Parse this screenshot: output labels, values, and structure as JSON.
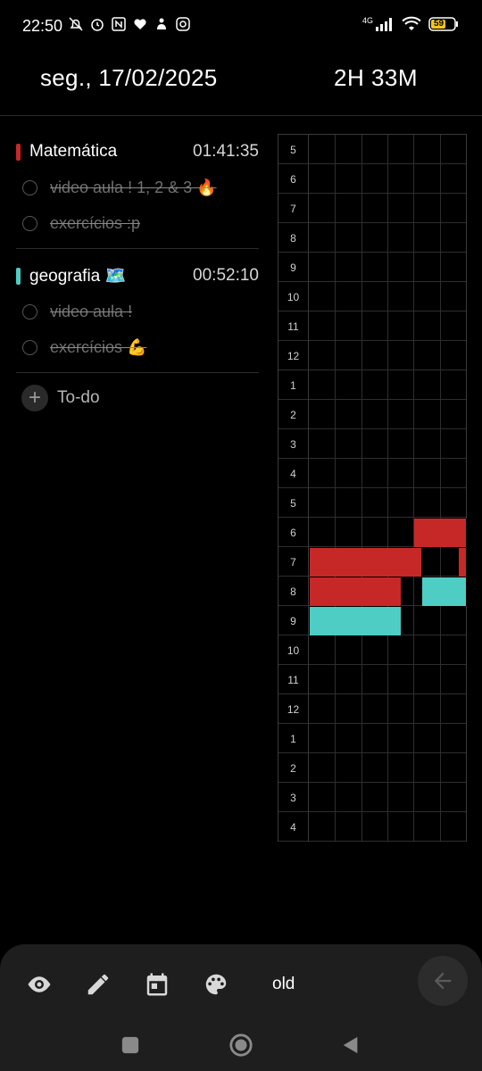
{
  "status_bar": {
    "time": "22:50",
    "battery": "59",
    "network": "4G"
  },
  "header": {
    "date": "seg., 17/02/2025",
    "total_time": "2H 33M"
  },
  "subjects": [
    {
      "name": "Matemática",
      "time": "01:41:35",
      "color": "#c62828",
      "tasks": [
        {
          "label": "video aula ! 1, 2 & 3 🔥",
          "done": true
        },
        {
          "label": "exercícios :p",
          "done": true
        }
      ]
    },
    {
      "name": "geografia 🗺️",
      "time": "00:52:10",
      "color": "#4ecdc4",
      "tasks": [
        {
          "label": "video aula !",
          "done": true
        },
        {
          "label": "exercícios 💪",
          "done": true
        }
      ]
    }
  ],
  "add_todo_label": "To-do",
  "grid": {
    "hours": [
      "5",
      "6",
      "7",
      "8",
      "9",
      "10",
      "11",
      "12",
      "1",
      "2",
      "3",
      "4",
      "5",
      "6",
      "7",
      "8",
      "9",
      "10",
      "11",
      "12",
      "1",
      "2",
      "3",
      "4"
    ],
    "colors": {
      "math": "#c62828",
      "geo": "#4ecdc4"
    },
    "segments": [
      {
        "row": 13,
        "start": 4,
        "end": 6,
        "subject": "math"
      },
      {
        "row": 14,
        "start": 0,
        "end": 4.3,
        "subject": "math"
      },
      {
        "row": 14,
        "start": 5.7,
        "end": 6,
        "subject": "math"
      },
      {
        "row": 15,
        "start": 0,
        "end": 3.5,
        "subject": "math"
      },
      {
        "row": 15,
        "start": 4.3,
        "end": 6,
        "subject": "geo"
      },
      {
        "row": 16,
        "start": 0,
        "end": 3.5,
        "subject": "geo"
      }
    ]
  },
  "bottom_bar": {
    "icons": [
      "eye-icon",
      "pencil-icon",
      "calendar-icon",
      "palette-icon",
      "arrow-left-icon"
    ],
    "mode_label": "old"
  }
}
